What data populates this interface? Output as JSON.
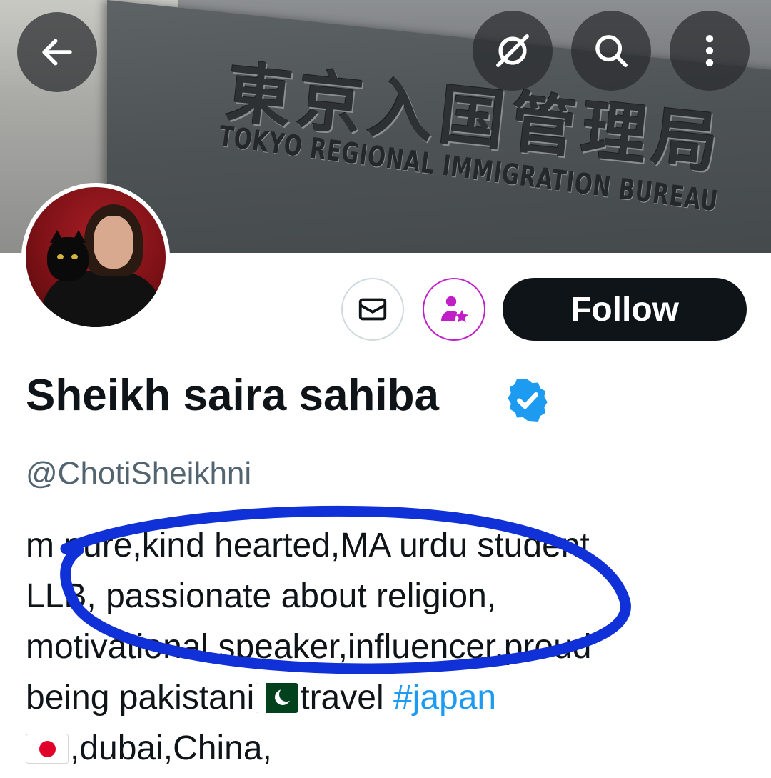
{
  "banner": {
    "kanji_text": "東京入国管理局",
    "caption_text": "TOKYO REGIONAL IMMIGRATION BUREAU"
  },
  "toolbar": {
    "back_icon": "arrow-left-icon",
    "grok_icon": "grok-icon",
    "search_icon": "search-icon",
    "more_icon": "more-vertical-icon"
  },
  "actions": {
    "message_icon": "envelope-icon",
    "subscribe_icon": "person-star-icon",
    "follow_label": "Follow"
  },
  "profile": {
    "display_name": "Sheikh saira sahiba",
    "verified": true,
    "handle": "@ChotiSheikhni",
    "bio": {
      "line1": "m pure,kind hearted,MA urdu student",
      "line2": "LLB, passionate about religion,",
      "line3": "motivational speaker,influencer,proud",
      "line4_text": "being pakistani",
      "line4_after_flag": "travel ",
      "line4_hashtag": "#japan",
      "line5_text": ",dubai,China,"
    }
  },
  "colors": {
    "follow_bg": "#0f1419",
    "verified_blue": "#1d9bf0",
    "hashtag_blue": "#1d9bf0",
    "subscribe_accent": "#c21ec8",
    "scribble_blue": "#1030d8",
    "handle_gray": "#536471"
  }
}
